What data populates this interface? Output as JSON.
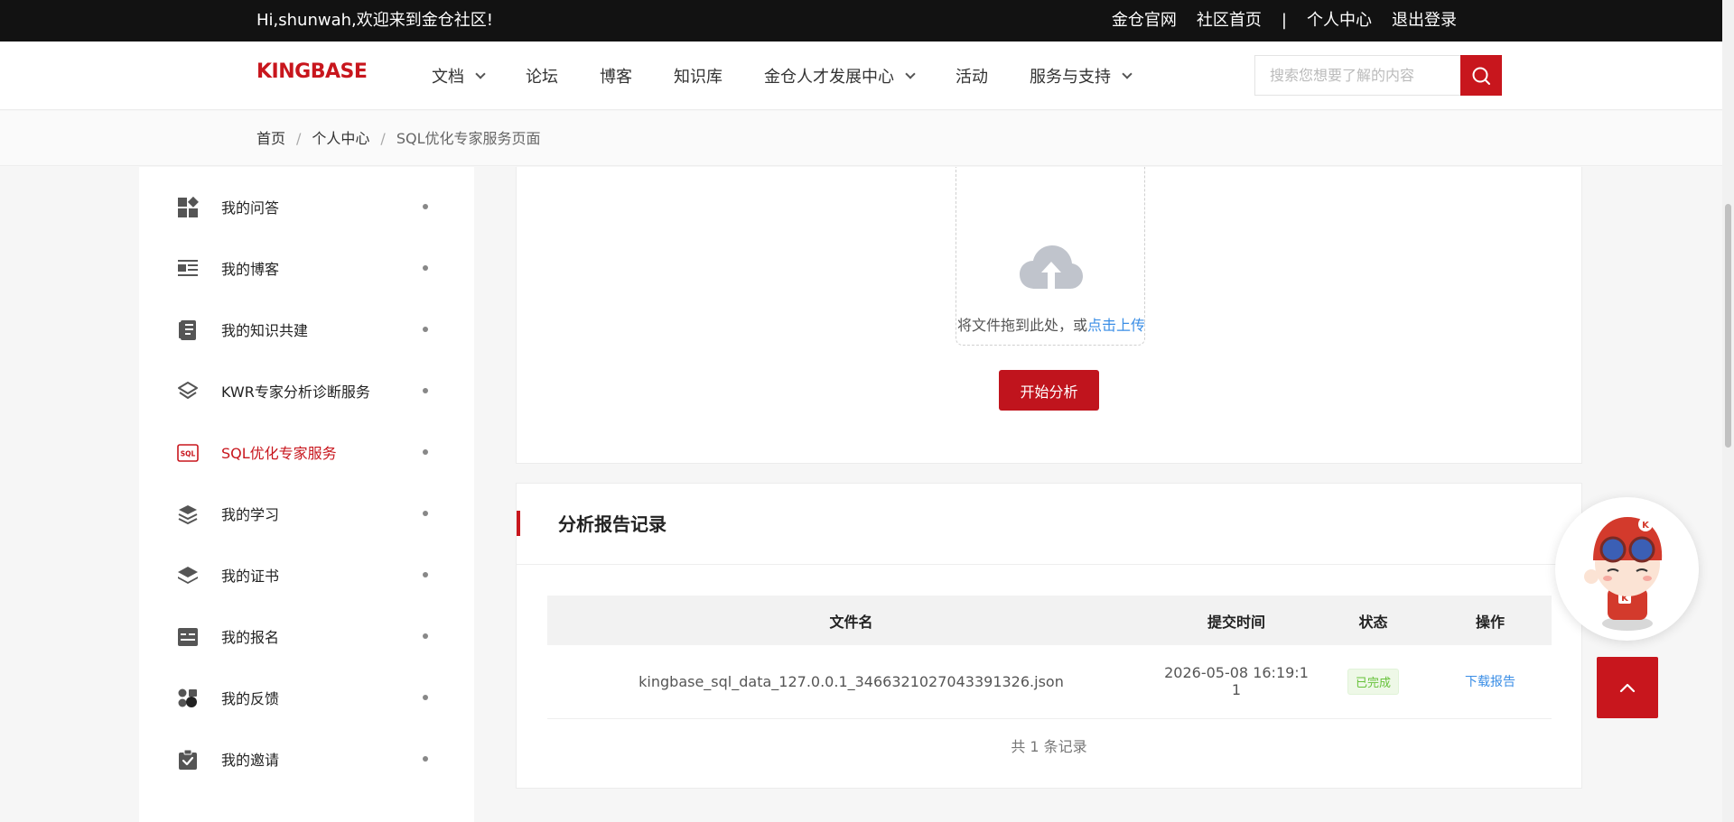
{
  "topbar": {
    "greeting": "Hi,shunwah,欢迎来到金仓社区!",
    "links": [
      "金仓官网",
      "社区首页",
      "|",
      "个人中心",
      "退出登录"
    ]
  },
  "navbar": {
    "logo": "KINGBASE",
    "items": [
      {
        "label": "文档",
        "dropdown": true
      },
      {
        "label": "论坛",
        "dropdown": false
      },
      {
        "label": "博客",
        "dropdown": false
      },
      {
        "label": "知识库",
        "dropdown": false
      },
      {
        "label": "金仓人才发展中心",
        "dropdown": true
      },
      {
        "label": "活动",
        "dropdown": false
      },
      {
        "label": "服务与支持",
        "dropdown": true
      }
    ],
    "search_placeholder": "搜索您想要了解的内容"
  },
  "breadcrumb": [
    "首页",
    "个人中心",
    "SQL优化专家服务页面"
  ],
  "sidebar": {
    "items": [
      {
        "label": "我的问答",
        "icon": "dashboard-icon"
      },
      {
        "label": "我的博客",
        "icon": "article-icon"
      },
      {
        "label": "我的知识共建",
        "icon": "notebook-icon"
      },
      {
        "label": "KWR专家分析诊断服务",
        "icon": "layers-outline-icon"
      },
      {
        "label": "SQL优化专家服务",
        "icon": "sql-icon",
        "active": true
      },
      {
        "label": "我的学习",
        "icon": "stack-icon"
      },
      {
        "label": "我的证书",
        "icon": "stack-filled-icon"
      },
      {
        "label": "我的报名",
        "icon": "id-card-icon"
      },
      {
        "label": "我的反馈",
        "icon": "feedback-icon"
      },
      {
        "label": "我的邀请",
        "icon": "clipboard-check-icon"
      }
    ]
  },
  "upload": {
    "hint_prefix": "将文件拖到此处，或",
    "hint_link": "点击上传",
    "start_button": "开始分析"
  },
  "reports": {
    "title": "分析报告记录",
    "columns": [
      "文件名",
      "提交时间",
      "状态",
      "操作"
    ],
    "rows": [
      {
        "filename": "kingbase_sql_data_127.0.0.1_3466321027043391326.json",
        "time_line1": "2026-05-08 16:19:1",
        "time_line2": "1",
        "status": "已完成",
        "action": "下载报告"
      }
    ],
    "total": "共 1 条记录"
  },
  "colors": {
    "brand": "#c8161d",
    "link": "#3a8ee6",
    "success": "#67c23a"
  }
}
